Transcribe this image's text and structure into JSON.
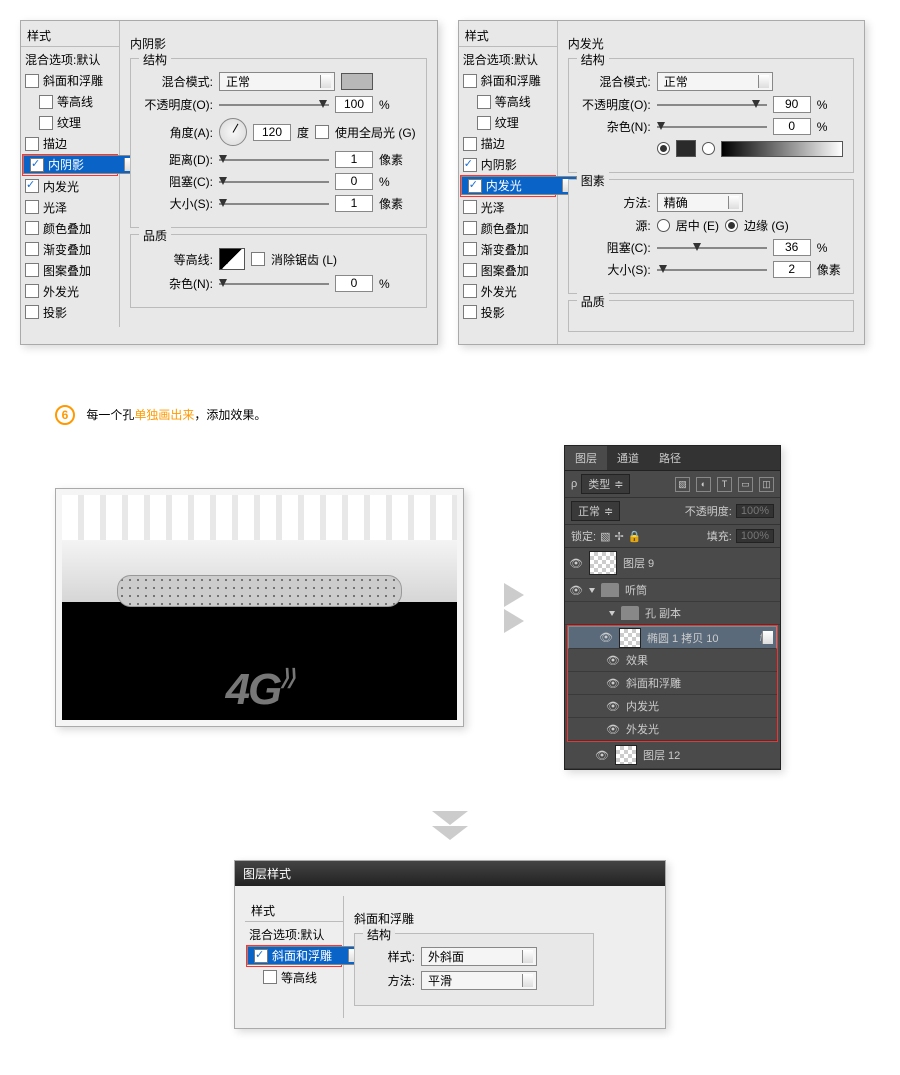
{
  "dialog1": {
    "styles_header": "样式",
    "blend_default": "混合选项:默认",
    "bevel": "斜面和浮雕",
    "contour": "等高线",
    "texture": "纹理",
    "stroke": "描边",
    "inner_shadow": "内阴影",
    "inner_glow": "内发光",
    "satin": "光泽",
    "color_overlay": "颜色叠加",
    "grad_overlay": "渐变叠加",
    "pattern_overlay": "图案叠加",
    "outer_glow": "外发光",
    "drop_shadow": "投影",
    "title": "内阴影",
    "grp_structure": "结构",
    "blend_mode": "混合模式:",
    "blend_val": "正常",
    "opacity": "不透明度(O):",
    "opacity_val": "100",
    "pct": "%",
    "angle": "角度(A):",
    "angle_val": "120",
    "deg": "度",
    "global": "使用全局光 (G)",
    "distance": "距离(D):",
    "distance_val": "1",
    "px": "像素",
    "choke": "阻塞(C):",
    "choke_val": "0",
    "size": "大小(S):",
    "size_val": "1",
    "grp_quality": "品质",
    "contour_lbl": "等高线:",
    "antialias": "消除锯齿 (L)",
    "noise": "杂色(N):",
    "noise_val": "0"
  },
  "dialog2": {
    "title": "内发光",
    "grp_structure": "结构",
    "blend_mode": "混合模式:",
    "blend_val": "正常",
    "opacity": "不透明度(O):",
    "opacity_val": "90",
    "pct": "%",
    "noise": "杂色(N):",
    "noise_val": "0",
    "grp_elements": "图素",
    "method": "方法:",
    "method_val": "精确",
    "source": "源:",
    "src_center": "居中 (E)",
    "src_edge": "边缘 (G)",
    "choke": "阻塞(C):",
    "choke_val": "36",
    "size": "大小(S):",
    "size_val": "2",
    "px": "像素",
    "grp_quality": "品质"
  },
  "step6": {
    "prefix": "每一个孔",
    "highlight": "单独画出来",
    "suffix": "，添加效果。"
  },
  "layers": {
    "tabs": {
      "layers": "图层",
      "channels": "通道",
      "paths": "路径"
    },
    "kind": "类型",
    "mode": "正常",
    "opacity_lbl": "不透明度:",
    "opacity": "100%",
    "lock": "锁定:",
    "fill_lbl": "填充:",
    "fill": "100%",
    "layer9": "图层 9",
    "group": "听筒",
    "subgroup": "孔 副本",
    "ellipse": "椭圆 1 拷贝 10",
    "effects": "效果",
    "e1": "斜面和浮雕",
    "e2": "内发光",
    "e3": "外发光",
    "layer12": "图层 12"
  },
  "final": {
    "window_title": "图层样式",
    "styles_header": "样式",
    "blend_default": "混合选项:默认",
    "bevel": "斜面和浮雕",
    "contour": "等高线",
    "title": "斜面和浮雕",
    "grp": "结构",
    "style": "样式:",
    "style_val": "外斜面",
    "method": "方法:",
    "method_val": "平滑"
  }
}
